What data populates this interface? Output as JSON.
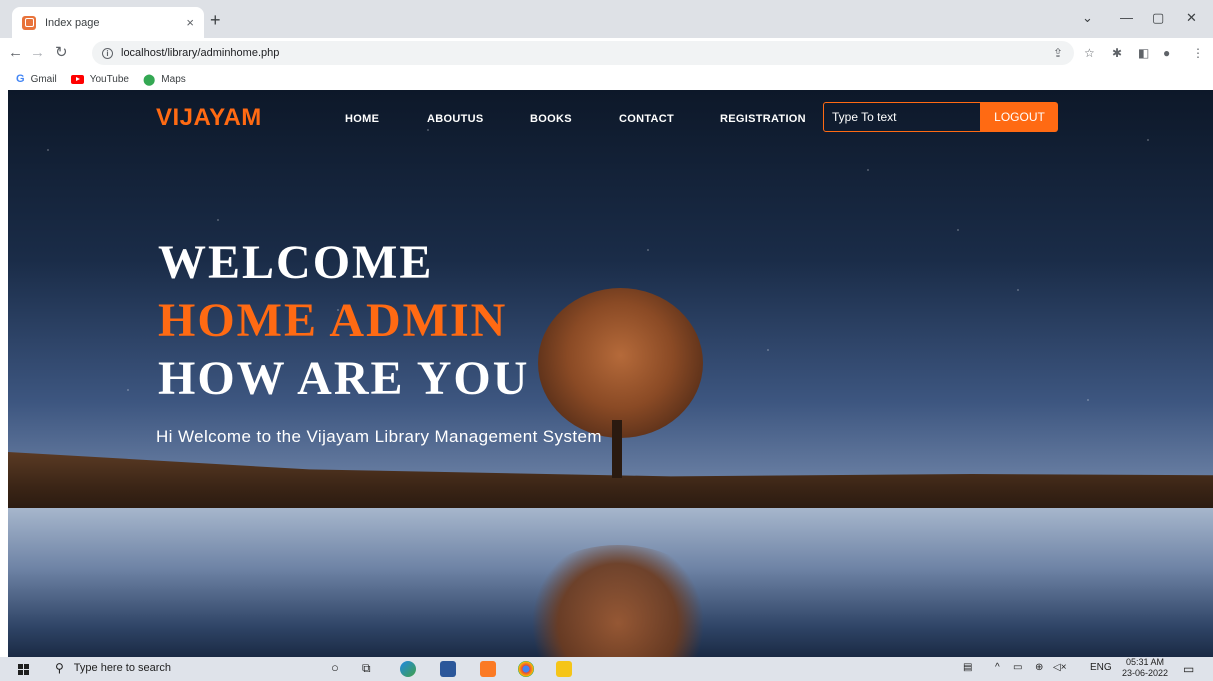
{
  "browser": {
    "tab_title": "Index page",
    "tab_close": "×",
    "new_tab": "+",
    "url": "localhost/library/adminhome.php",
    "bookmarks": [
      {
        "icon": "G",
        "label": "Gmail"
      },
      {
        "label": "YouTube"
      },
      {
        "label": "Maps"
      }
    ]
  },
  "nav": {
    "brand": "VIJAYAM",
    "links": [
      "HOME",
      "ABOUTUS",
      "BOOKS",
      "CONTACT",
      "REGISTRATION"
    ],
    "search_placeholder": "Type To text",
    "logout": "LOGOUT"
  },
  "hero": {
    "line1": "WELCOME",
    "line2": "HOME ADMIN",
    "line3": "HOW ARE YOU",
    "subtitle": "Hi Welcome to the Vijayam Library Management System"
  },
  "taskbar": {
    "search_placeholder": "Type here to search",
    "lang": "ENG",
    "time": "05:31 AM",
    "date": "23-06-2022"
  },
  "colors": {
    "accent": "#ff6a13",
    "white_text": "#ffffff"
  }
}
